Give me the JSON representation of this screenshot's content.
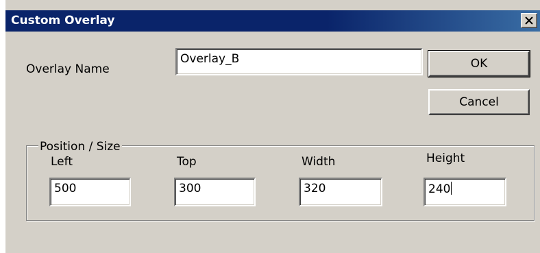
{
  "dialog": {
    "title": "Custom Overlay",
    "close_icon": "close-icon"
  },
  "form": {
    "name_label": "Overlay Name",
    "name_value": "Overlay_B"
  },
  "buttons": {
    "ok_label": "OK",
    "cancel_label": "Cancel"
  },
  "position_group": {
    "legend": "Position / Size",
    "left_label": "Left",
    "left_value": "500",
    "top_label": "Top",
    "top_value": "300",
    "width_label": "Width",
    "width_value": "320",
    "height_label": "Height",
    "height_value": "240"
  },
  "colors": {
    "titlebar": "#0a246a",
    "dialog_bg": "#d4d0c8"
  }
}
